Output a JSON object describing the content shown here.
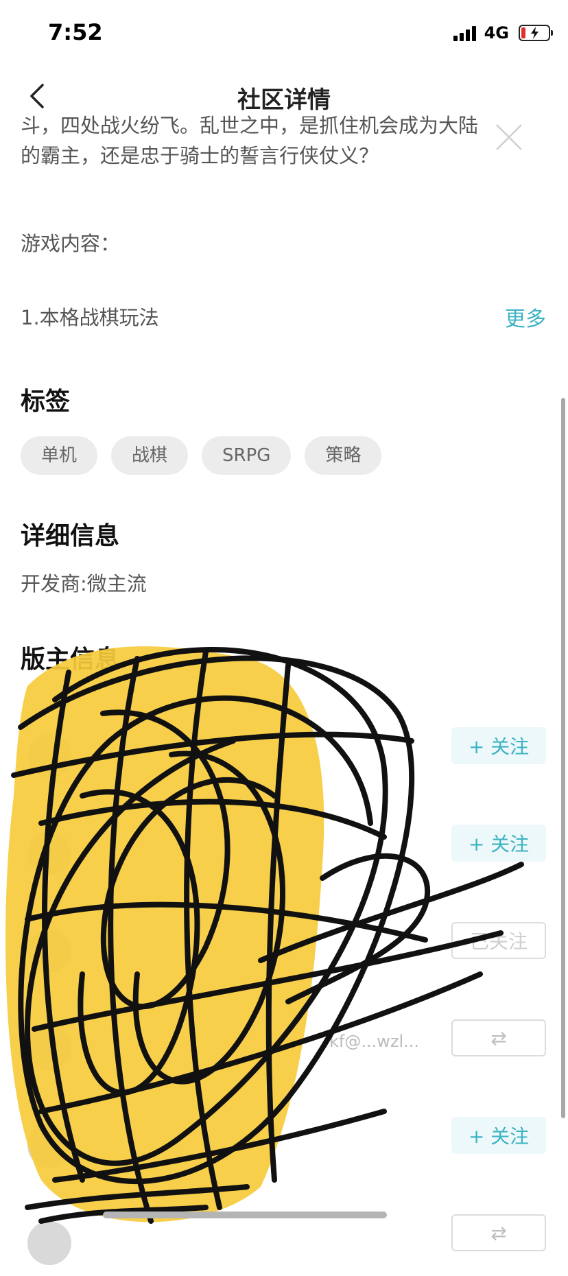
{
  "status_bar": {
    "time": "7:52",
    "network": "4G",
    "battery_level": 0.15,
    "battery_charging": true
  },
  "header": {
    "title": "社区详情",
    "back_icon": "chevron-left-icon"
  },
  "intro": {
    "line1": "斗，四处战火纷飞。乱世之中，是抓住机会成为大陆",
    "line2": "的霸主，还是忠于骑士的誓言行侠仗义？"
  },
  "game_content": {
    "label": "游戏内容：",
    "item1": "1.本格战棋玩法",
    "more": "更多"
  },
  "tags": {
    "title": "标签",
    "items": [
      "单机",
      "战棋",
      "SRPG",
      "策略"
    ]
  },
  "details": {
    "title": "详细信息",
    "developer": "开发商:微主流"
  },
  "moderators": {
    "title": "版主信息",
    "rows": [
      {
        "button": "+ 关注",
        "state": "follow"
      },
      {
        "button": "+ 关注",
        "state": "follow"
      },
      {
        "button": "已关注",
        "state": "followed"
      },
      {
        "button": "⇄",
        "state": "mutual",
        "subtitle": "kf@...wzl..."
      },
      {
        "button": "+ 关注",
        "state": "follow"
      },
      {
        "button": "⇄",
        "state": "mutual"
      }
    ]
  },
  "colors": {
    "accent": "#3bb3c3",
    "tag_bg": "#ececec",
    "scribble": "#111111",
    "highlight": "#f6cb3b"
  }
}
